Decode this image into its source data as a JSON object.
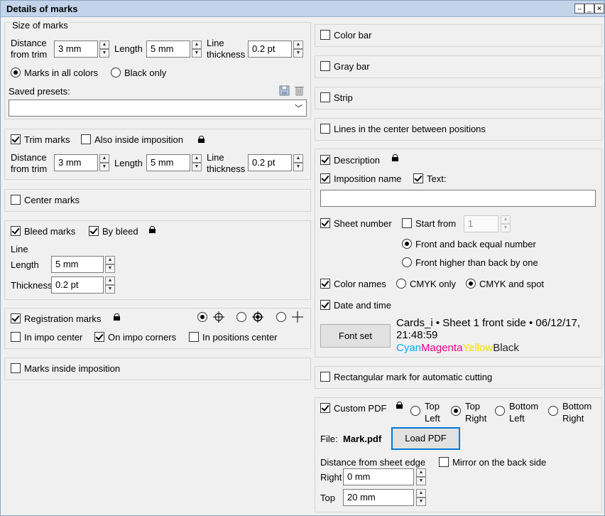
{
  "window": {
    "title": "Details of marks"
  },
  "size_of_marks": {
    "heading": "Size of marks",
    "distance_label": "Distance\nfrom trim",
    "distance_value": "3 mm",
    "length_label": "Length",
    "length_value": "5 mm",
    "line_label": "Line\nthickness",
    "line_value": "0.2 pt",
    "color_mode": {
      "all_colors": "Marks in all colors",
      "black_only": "Black only",
      "selected": "all_colors"
    },
    "presets_label": "Saved presets:",
    "presets_value": ""
  },
  "trim_marks": {
    "label": "Trim marks",
    "checked": true,
    "also_inside": "Also inside imposition",
    "also_inside_checked": false,
    "distance_label": "Distance\nfrom trim",
    "distance_value": "3 mm",
    "length_label": "Length",
    "length_value": "5 mm",
    "line_label": "Line\nthickness",
    "line_value": "0.2 pt"
  },
  "center_marks": {
    "label": "Center marks",
    "checked": false
  },
  "bleed_marks": {
    "label": "Bleed marks",
    "checked": true,
    "by_bleed": "By bleed",
    "by_bleed_checked": true,
    "line_heading": "Line",
    "length_label": "Length",
    "length_value": "5 mm",
    "thickness_label": "Thickness",
    "thickness_value": "0.2 pt"
  },
  "registration_marks": {
    "label": "Registration marks",
    "checked": true,
    "style_selected": "crosshair-circle",
    "in_impo_center": "In impo center",
    "in_impo_center_checked": false,
    "on_impo_corners": "On impo corners",
    "on_impo_corners_checked": true,
    "in_positions_center": "In positions center",
    "in_positions_center_checked": false
  },
  "marks_inside": {
    "label": "Marks inside imposition",
    "checked": false
  },
  "color_bar": {
    "label": "Color bar",
    "checked": false
  },
  "gray_bar": {
    "label": "Gray bar",
    "checked": false
  },
  "strip": {
    "label": "Strip",
    "checked": false
  },
  "lines_center": {
    "label": "Lines in the center between positions",
    "checked": false
  },
  "description": {
    "label": "Description",
    "checked": true,
    "imposition_name": "Imposition name",
    "imposition_name_checked": true,
    "text_label": "Text:",
    "text_checked": true,
    "text_value": "",
    "sheet_number": "Sheet number",
    "sheet_number_checked": true,
    "start_from": "Start from",
    "start_from_checked": false,
    "start_from_value": "1",
    "front_back_equal": "Front and back equal number",
    "front_higher": "Front higher than back by one",
    "sheet_mode_selected": "equal",
    "color_names": "Color names",
    "color_names_checked": true,
    "cmyk_only": "CMYK only",
    "cmyk_and_spot": "CMYK and spot",
    "color_mode_selected": "cmyk_and_spot",
    "date_time": "Date and time",
    "date_time_checked": true,
    "font_set": "Font set",
    "preview_line1": "Cards_i • Sheet 1 front side • 06/12/17,",
    "preview_line2": "21:48:59",
    "preview_colors": [
      {
        "text": "Cyan",
        "color": "#00aeef"
      },
      {
        "text": "Magenta",
        "color": "#ec008c"
      },
      {
        "text": "Yellow",
        "color": "#fff200"
      },
      {
        "text": "Black",
        "color": "#231f20"
      }
    ]
  },
  "rect_mark": {
    "label": "Rectangular mark for automatic cutting",
    "checked": false
  },
  "custom_pdf": {
    "label": "Custom PDF",
    "checked": true,
    "positions": {
      "top_left": "Top\nLeft",
      "top_right": "Top\nRight",
      "bottom_left": "Bottom\nLeft",
      "bottom_right": "Bottom\nRight",
      "selected": "top_right"
    },
    "file_label": "File:",
    "file_name": "Mark.pdf",
    "load_button": "Load PDF",
    "distance_heading": "Distance from sheet edge",
    "mirror": "Mirror on the back side",
    "mirror_checked": false,
    "right_label": "Right",
    "right_value": "0 mm",
    "top_label": "Top",
    "top_value": "20 mm"
  }
}
